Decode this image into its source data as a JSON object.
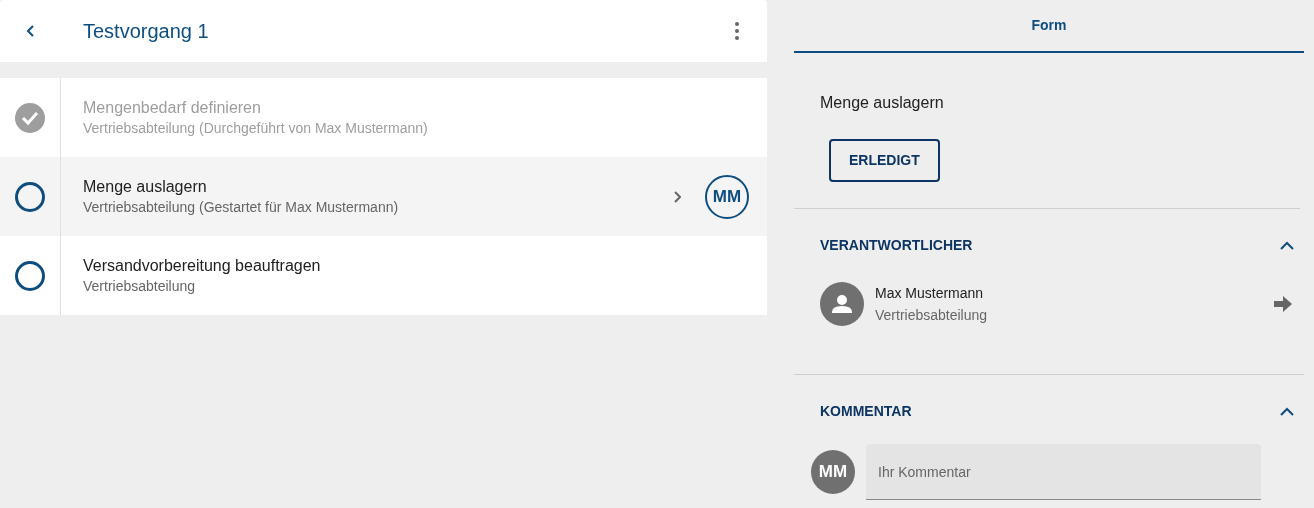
{
  "header": {
    "title": "Testvorgang 1"
  },
  "steps": [
    {
      "title": "Mengenbedarf definieren",
      "subtitle": "Vertriebsabteilung (Durchgeführt von Max Mustermann)",
      "completed": true,
      "selected": false
    },
    {
      "title": "Menge auslagern",
      "subtitle": "Vertriebsabteilung (Gestartet für Max Mustermann)",
      "completed": false,
      "selected": true,
      "assignee": "MM"
    },
    {
      "title": "Versandvorbereitung beauftragen",
      "subtitle": "Vertriebsabteilung",
      "completed": false,
      "selected": false
    }
  ],
  "tabs": [
    {
      "label": "Form",
      "selected": true
    }
  ],
  "form": {
    "task_title": "Menge auslagern",
    "button": "ERLEDIGT"
  },
  "responsible": {
    "heading": "VERANTWORTLICHER",
    "expanded": true,
    "name": "Max Mustermann",
    "department": "Vertriebsabteilung"
  },
  "comment": {
    "heading": "KOMMENTAR",
    "expanded": true,
    "avatar": "MM",
    "placeholder": "Ihr Kommentar"
  }
}
